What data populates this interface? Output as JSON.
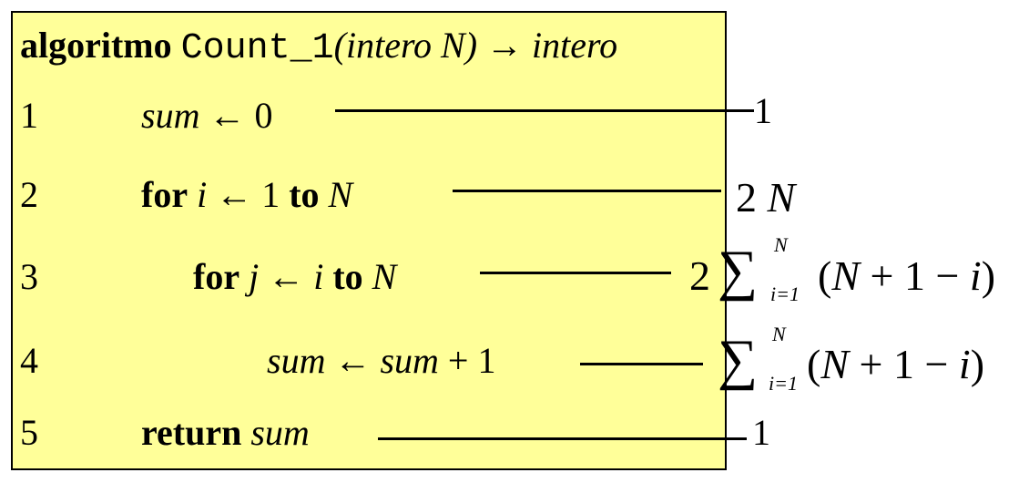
{
  "header": {
    "keyword": "algoritmo",
    "name": "Count_1",
    "param": "(intero N)",
    "arrow": "→",
    "return_type": "intero"
  },
  "lines": [
    {
      "num": "1",
      "tokens": [
        [
          "sum",
          "i"
        ],
        [
          " ← 0",
          ""
        ]
      ]
    },
    {
      "num": "2",
      "tokens": [
        [
          "for",
          "b"
        ],
        [
          " ",
          ""
        ],
        [
          "i",
          "i"
        ],
        [
          " ← 1 ",
          ""
        ],
        [
          "to",
          "b"
        ],
        [
          " ",
          ""
        ],
        [
          "N",
          "i"
        ]
      ]
    },
    {
      "num": "3",
      "tokens": [
        [
          "for",
          "b"
        ],
        [
          " ",
          ""
        ],
        [
          "j",
          "i"
        ],
        [
          " ← ",
          ""
        ],
        [
          "i",
          "i"
        ],
        [
          " ",
          ""
        ],
        [
          "to",
          "b"
        ],
        [
          " ",
          ""
        ],
        [
          "N",
          "i"
        ]
      ]
    },
    {
      "num": "4",
      "tokens": [
        [
          "sum",
          "i"
        ],
        [
          " ← ",
          ""
        ],
        [
          "sum",
          "i"
        ],
        [
          " + 1",
          ""
        ]
      ]
    },
    {
      "num": "5",
      "tokens": [
        [
          "return",
          "b"
        ],
        [
          " ",
          ""
        ],
        [
          "sum",
          "i"
        ]
      ]
    }
  ],
  "costs": {
    "line1": "1",
    "line2_coef": "2",
    "line2_var": "N",
    "line3_coef": "2",
    "sum_symbol": "∑",
    "sum_upper": "N",
    "sum_lower": "i=1",
    "summand_open": "(",
    "summand_N": "N",
    "summand_plus": "+ 1 −",
    "summand_i": "i",
    "summand_close": ")",
    "line5": "1"
  }
}
